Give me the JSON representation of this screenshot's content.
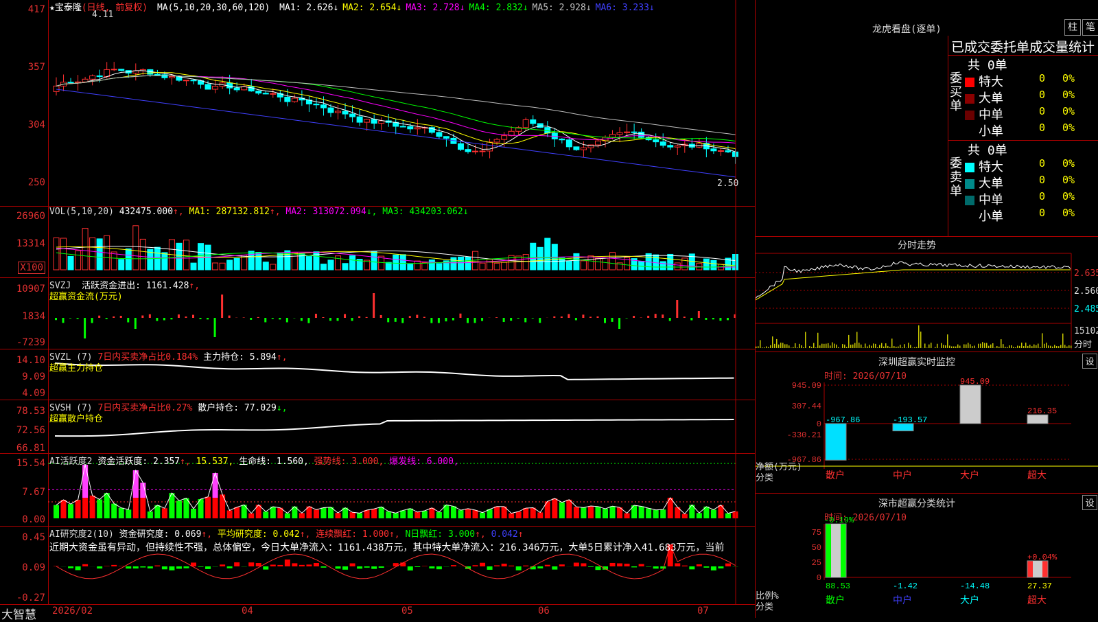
{
  "main": {
    "star_name": "★宝泰隆",
    "mode": "(日线, 前复权)",
    "ma_label": "MA(5,10,20,30,60,120)",
    "ma_items": [
      {
        "label": "MA1:",
        "value": "2.626",
        "arrow": "↓",
        "color": "#ffffff"
      },
      {
        "label": "MA2:",
        "value": "2.654",
        "arrow": "↓",
        "color": "#ffff00"
      },
      {
        "label": "MA3:",
        "value": "2.728",
        "arrow": "↓",
        "color": "#ff00ff"
      },
      {
        "label": "MA4:",
        "value": "2.832",
        "arrow": "↓",
        "color": "#00ff00"
      },
      {
        "label": "MA5:",
        "value": "2.928",
        "arrow": "↓",
        "color": "#c0c0c0"
      },
      {
        "label": "MA6:",
        "value": "3.233",
        "arrow": "↓",
        "color": "#4040ff"
      }
    ],
    "high_label": "4.11",
    "low_label": "2.50",
    "y_ticks": [
      "417",
      "357",
      "304",
      "250"
    ]
  },
  "vol": {
    "label": "VOL(5,10,20)",
    "value": "432475.000",
    "ma1": "MA1: 287132.812",
    "ma2": "MA2: 313072.094",
    "ma3": "MA3: 434203.062",
    "y_ticks": [
      "26960",
      "13314"
    ],
    "unit": "X100"
  },
  "svzj": {
    "label": "SVZJ",
    "line1": "活跃资金进出: 1161.428",
    "line2": "超赢资金流(万元)",
    "y_ticks": [
      "10907",
      "1834",
      "-7239"
    ]
  },
  "svzl": {
    "label": "SVZL (7)",
    "pct": "7日内买卖净占比0.184%",
    "hold": "主力持仓: 5.894",
    "line2": "超赢主力持仓",
    "y_ticks": [
      "14.10",
      "9.09",
      "4.09"
    ]
  },
  "svsh": {
    "label": "SVSH (7)",
    "pct": "7日内买卖净占比0.27%",
    "hold": "散户持仓: 77.029",
    "line2": "超赢散户持仓",
    "y_ticks": [
      "78.53",
      "72.56",
      "66.81"
    ]
  },
  "ai1": {
    "label": "AI活跃度2",
    "v1": "资金活跃度: 2.357",
    "v2": "15.537,",
    "v3": "生命线: 1.560,",
    "v4": "强势线: 3.000,",
    "v5": "爆发线: 6.000,",
    "y_ticks": [
      "15.54",
      "7.67",
      "0.00"
    ]
  },
  "ai2": {
    "label": "AI研究度2(10)",
    "v1": "资金研究度: 0.069",
    "v2": "平均研究度: 0.042",
    "v3": "连续飘红: 1.000",
    "v4": "N日飘红: 3.000",
    "v5": "0.042",
    "comment": "近期大资金虽有异动，但持续性不强，总体偏空，今日大单净流入：1161.438万元，其中特大单净流入：216.346万元，大单5日累计净入41.683万元，当前",
    "y_ticks": [
      "0.45",
      "0.09",
      "-0.27"
    ]
  },
  "xaxis": {
    "brand": "大智慧",
    "labels": [
      "2026/02",
      "04",
      "05",
      "06",
      "07"
    ]
  },
  "right": {
    "lh_title": "龙虎看盘(逐单)",
    "btn1": "柱",
    "btn2": "笔",
    "stat_title": "已成交委托单成交量统计",
    "buy_side": "委买单",
    "sell_side": "委卖单",
    "buy_total": "共 0单",
    "sell_total": "共 0单",
    "rows": [
      {
        "name": "特大",
        "val": "0",
        "pct": "0%",
        "color": "#ff0000"
      },
      {
        "name": "大单",
        "val": "0",
        "pct": "0%",
        "color": "#8b0000"
      },
      {
        "name": "中单",
        "val": "0",
        "pct": "0%",
        "color": "#6b0000"
      },
      {
        "name": "小单",
        "val": "0",
        "pct": "0%",
        "color": "#000000"
      }
    ],
    "sell_rows": [
      {
        "name": "特大",
        "val": "0",
        "pct": "0%",
        "color": "#00ffff"
      },
      {
        "name": "大单",
        "val": "0",
        "pct": "0%",
        "color": "#008b8b"
      },
      {
        "name": "中单",
        "val": "0",
        "pct": "0%",
        "color": "#006b6b"
      },
      {
        "name": "小单",
        "val": "0",
        "pct": "0%",
        "color": "#000000"
      }
    ],
    "fs_title": "分时走势",
    "fs_ticks": [
      "2.635",
      "2.560",
      "2.485"
    ],
    "fs_vol": "15102",
    "fs_unit": "分时",
    "mon_title": "深圳超赢实时监控",
    "set": "设",
    "time_label": "时间: 2026/07/10",
    "mon_ticks": [
      "945.09",
      "307.44",
      "0",
      "-330.21",
      "-967.86"
    ],
    "mon_bars": [
      {
        "label": "-967.86",
        "value": -967.86
      },
      {
        "label": "-193.57",
        "value": -193.57
      },
      {
        "label": "945.09",
        "value": 945.09
      },
      {
        "label": "216.35",
        "value": 216.35
      }
    ],
    "net_label": "净额(万元)",
    "cls_label": "分类",
    "cats": [
      "散户",
      "中户",
      "大户",
      "超大"
    ],
    "cls_title": "深市超赢分类统计",
    "time2": "时间: 2026/07/10",
    "ratio_label": "比例%",
    "ratio_ticks": [
      "75",
      "50",
      "25",
      "0"
    ],
    "top1": "-0.19%",
    "top4": "+0.04%",
    "ratio_vals": [
      "88.53",
      "-1.42",
      "-14.48",
      "27.37"
    ]
  }
}
